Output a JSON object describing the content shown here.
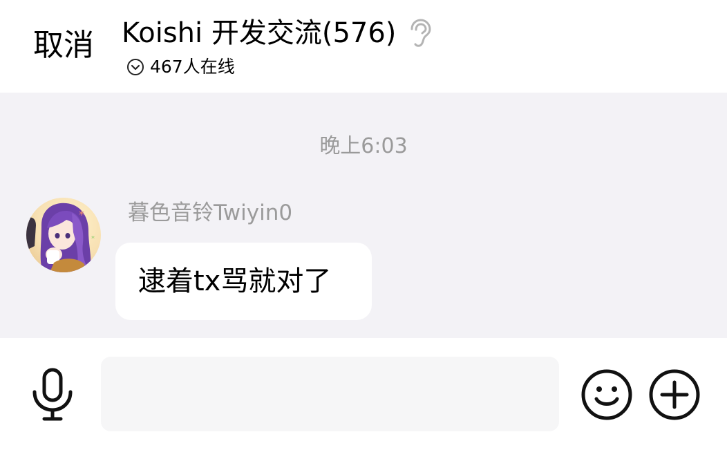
{
  "header": {
    "cancel_label": "取消",
    "group_name": "Koishi 开发交流(576)",
    "online_status": "467人在线",
    "listen_icon": "ear-icon",
    "expand_icon": "chevron-down-circle-icon"
  },
  "chat": {
    "timestamp": "晚上6:03",
    "messages": [
      {
        "sender": "暮色音铃Twiyin0",
        "text": "逮着tx骂就对了",
        "avatar": "anime-girl-purple-hair-avatar"
      }
    ]
  },
  "input_bar": {
    "voice_icon": "microphone-icon",
    "input_value": "",
    "emoji_icon": "smiley-face-icon",
    "more_icon": "plus-circle-icon"
  },
  "colors": {
    "chat_background": "#f3f2f6",
    "bubble_background": "#ffffff",
    "secondary_text": "#9a9a9a",
    "input_background": "#f6f6f7"
  }
}
